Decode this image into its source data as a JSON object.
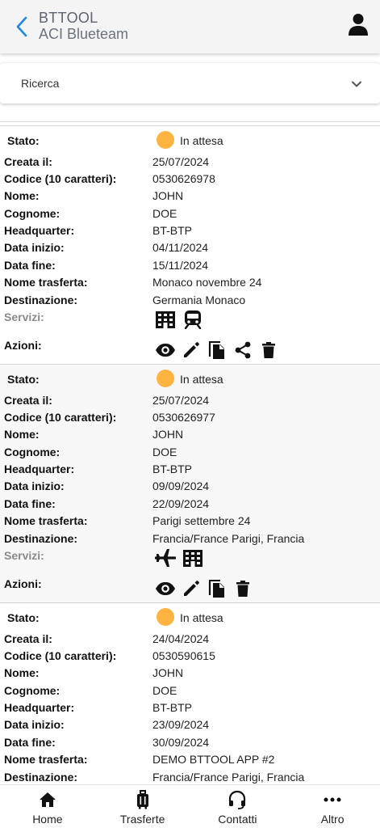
{
  "header": {
    "title": "BTTOOL",
    "subtitle": "ACI Blueteam"
  },
  "search": {
    "label": "Ricerca"
  },
  "labels": {
    "stato": "Stato:",
    "creata": "Creata il:",
    "codice": "Codice (10 caratteri):",
    "nome": "Nome:",
    "cognome": "Cognome:",
    "headquarter": "Headquarter:",
    "data_inizio": "Data inizio:",
    "data_fine": "Data fine:",
    "nome_trasferta": "Nome trasferta:",
    "destinazione": "Destinazione:",
    "servizi": "Servizi:",
    "azioni": "Azioni:"
  },
  "records": [
    {
      "stato": "In attesa",
      "creata": "25/07/2024",
      "codice": "0530626978",
      "nome": "JOHN",
      "cognome": "DOE",
      "headquarter": "BT-BTP",
      "data_inizio": "04/11/2024",
      "data_fine": "15/11/2024",
      "nome_trasferta": "Monaco novembre 24",
      "destinazione": "Germania Monaco",
      "servizi": [
        "hotel-icon",
        "train-icon"
      ],
      "azioni": [
        "view-icon",
        "edit-icon",
        "copy-icon",
        "share-icon",
        "delete-icon"
      ]
    },
    {
      "stato": "In attesa",
      "creata": "25/07/2024",
      "codice": "0530626977",
      "nome": "JOHN",
      "cognome": "DOE",
      "headquarter": "BT-BTP",
      "data_inizio": "09/09/2024",
      "data_fine": "22/09/2024",
      "nome_trasferta": "Parigi settembre 24",
      "destinazione": "Francia/France Parigi, Francia",
      "servizi": [
        "flight-icon",
        "hotel-icon"
      ],
      "azioni": [
        "view-icon",
        "edit-icon",
        "copy-icon",
        "delete-icon"
      ]
    },
    {
      "stato": "In attesa",
      "creata": "24/04/2024",
      "codice": "0530590615",
      "nome": "JOHN",
      "cognome": "DOE",
      "headquarter": "BT-BTP",
      "data_inizio": "23/09/2024",
      "data_fine": "30/09/2024",
      "nome_trasferta": "DEMO BTTOOL APP #2",
      "destinazione": "Francia/France Parigi, Francia",
      "servizi": [],
      "azioni": []
    }
  ],
  "nav": {
    "home": "Home",
    "trasferte": "Trasferte",
    "contatti": "Contatti",
    "altro": "Altro"
  },
  "colors": {
    "status_pending": "#ffb341",
    "accent": "#1e88e5"
  }
}
